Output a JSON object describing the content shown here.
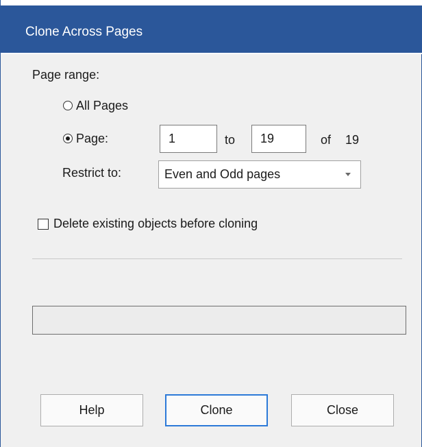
{
  "window": {
    "title": "Clone Across Pages"
  },
  "page_range": {
    "label": "Page range:",
    "all_pages_label": "All Pages",
    "all_pages_selected": false,
    "page_label": "Page:",
    "page_selected": true,
    "from_value": "1",
    "to_label": "to",
    "to_value": "19",
    "of_label": "of",
    "total_pages": "19"
  },
  "restrict": {
    "label": "Restrict to:",
    "selected": "Even and Odd pages"
  },
  "delete_existing": {
    "label": "Delete existing objects before cloning",
    "checked": false
  },
  "progress": {
    "value": 0
  },
  "buttons": {
    "help": "Help",
    "clone": "Clone",
    "close": "Close"
  },
  "colors": {
    "title_bar": "#2b579a",
    "dialog_bg": "#f0f0f0",
    "default_button_border": "#2b79d8"
  },
  "icons": {
    "dropdown": "chevron-down-icon"
  }
}
